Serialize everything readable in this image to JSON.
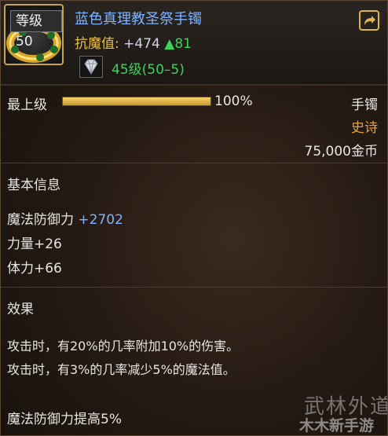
{
  "item": {
    "level_badge": "等级50",
    "name": "蓝色真理教圣祭手镯",
    "resist_label": "抗魔值:",
    "resist_value": "+474",
    "resist_gain": "▲81",
    "gem_level": "45级(50–5)"
  },
  "quality": {
    "label": "最上级",
    "percent_text": "100%",
    "fill_fraction": 1.0
  },
  "meta": {
    "slot": "手镯",
    "rarity": "史诗",
    "price": "75,000金币"
  },
  "basic_info": {
    "title": "基本信息",
    "stats": [
      {
        "label": "魔法防御力 ",
        "bonus": "+2702"
      },
      {
        "label": "力量+26",
        "bonus": ""
      },
      {
        "label": "体力+66",
        "bonus": ""
      }
    ]
  },
  "effects": {
    "title": "效果",
    "lines": [
      "攻击时，有20%的几率附加10%的伤害。",
      "攻击时，有3%的几率减少5%的魔法值。"
    ],
    "extra": "魔法防御力提高5%"
  },
  "watermark": {
    "line1": "武林外道",
    "line2": "木木新手游"
  },
  "colors": {
    "name_blue": "#7fb2ff",
    "resist_gold": "#e6c14d",
    "gain_green": "#3fd25a",
    "rarity_orange": "#e8a23a",
    "progress_gold": "#e8bf4a"
  },
  "icons": {
    "item": "gold-bracelet-icon",
    "gem": "diamond-gem-icon",
    "share": "share-export-icon"
  }
}
